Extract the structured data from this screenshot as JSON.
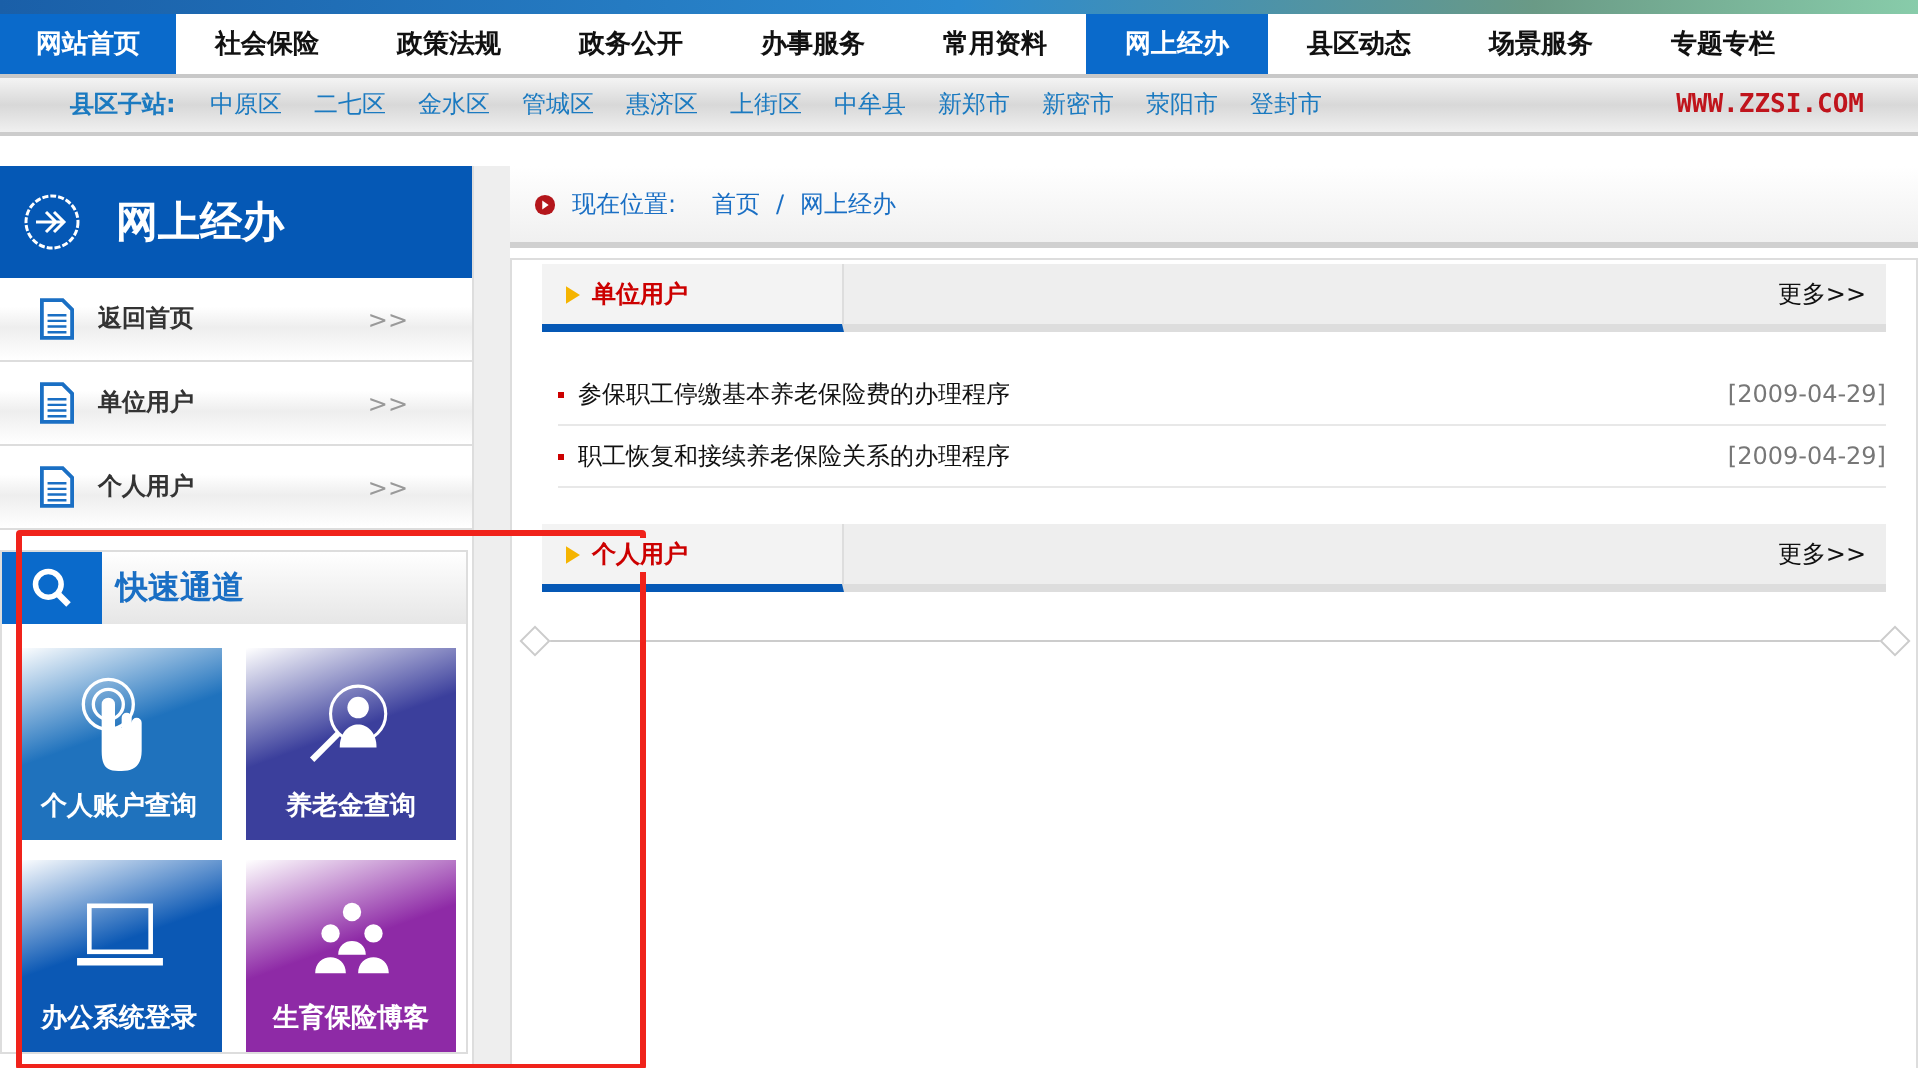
{
  "nav": {
    "items": [
      {
        "label": "网站首页",
        "selected": true
      },
      {
        "label": "社会保险",
        "selected": false
      },
      {
        "label": "政策法规",
        "selected": false
      },
      {
        "label": "政务公开",
        "selected": false
      },
      {
        "label": "办事服务",
        "selected": false
      },
      {
        "label": "常用资料",
        "selected": false
      },
      {
        "label": "网上经办",
        "selected": true
      },
      {
        "label": "县区动态",
        "selected": false
      },
      {
        "label": "场景服务",
        "selected": false
      },
      {
        "label": "专题专栏",
        "selected": false
      }
    ]
  },
  "subnav": {
    "label": "县区子站:",
    "links": [
      "中原区",
      "二七区",
      "金水区",
      "管城区",
      "惠济区",
      "上街区",
      "中牟县",
      "新郑市",
      "新密市",
      "荥阳市",
      "登封市"
    ],
    "site": "WWW.ZZSI.COM"
  },
  "sidebar": {
    "title": "网上经办",
    "items": [
      {
        "label": "返回首页",
        "arrow": ">>"
      },
      {
        "label": "单位用户",
        "arrow": ">>"
      },
      {
        "label": "个人用户",
        "arrow": ">>"
      }
    ],
    "quick": {
      "title": "快速通道",
      "tiles": [
        {
          "label": "个人账户查询",
          "kind": "touch",
          "color": "#1f72bd"
        },
        {
          "label": "养老金查询",
          "kind": "search",
          "color": "#3b3f9c"
        },
        {
          "label": "办公系统登录",
          "kind": "laptop",
          "color": "#0b58b4"
        },
        {
          "label": "生育保险博客",
          "kind": "group",
          "color": "#8e2aa6"
        }
      ]
    }
  },
  "breadcrumb": {
    "label": "现在位置:",
    "items": [
      "首页",
      "网上经办"
    ],
    "separator": "/"
  },
  "sections": [
    {
      "title": "单位用户",
      "more": "更多>>",
      "rows": [
        {
          "title": "参保职工停缴基本养老保险费的办理程序",
          "date": "[2009-04-29]"
        },
        {
          "title": "职工恢复和接续养老保险关系的办理程序",
          "date": "[2009-04-29]"
        }
      ]
    },
    {
      "title": "个人用户",
      "more": "更多>>"
    }
  ]
}
